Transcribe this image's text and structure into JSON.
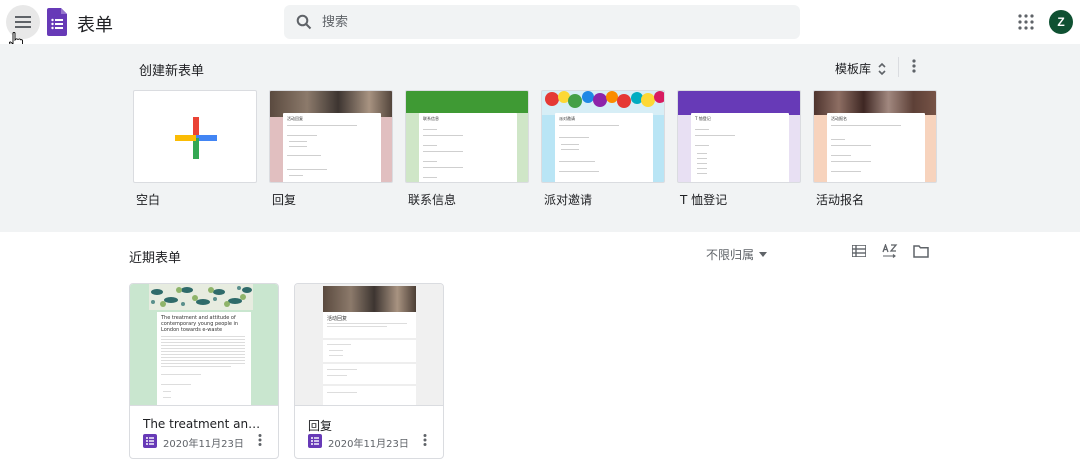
{
  "header": {
    "app_title": "表单",
    "search_placeholder": "搜索",
    "avatar_letter": "Z"
  },
  "templates": {
    "heading": "创建新表单",
    "gallery_label": "模板库",
    "items": [
      {
        "label": "空白"
      },
      {
        "label": "回复",
        "form_title": "活动回复"
      },
      {
        "label": "联系信息",
        "form_title": "联系信息"
      },
      {
        "label": "派对邀请",
        "form_title": "派对邀请"
      },
      {
        "label": "T 恤登记",
        "form_title": "T 恤登记"
      },
      {
        "label": "活动报名",
        "form_title": "活动报名"
      }
    ]
  },
  "recent": {
    "heading": "近期表单",
    "owner_filter": "不限归属",
    "docs": [
      {
        "title": "The treatment and attitud...",
        "date": "2020年11月23日",
        "thumb_title": "The treatment and attitude of contemporary young people in London towards e-waste"
      },
      {
        "title": "回复",
        "date": "2020年11月23日",
        "thumb_title": "活动回复"
      }
    ]
  },
  "colors": {
    "forms_purple": "#673ab7",
    "header_bg": "#ffffff",
    "section_bg": "#f1f3f4",
    "avatar_bg": "#0f5132"
  }
}
